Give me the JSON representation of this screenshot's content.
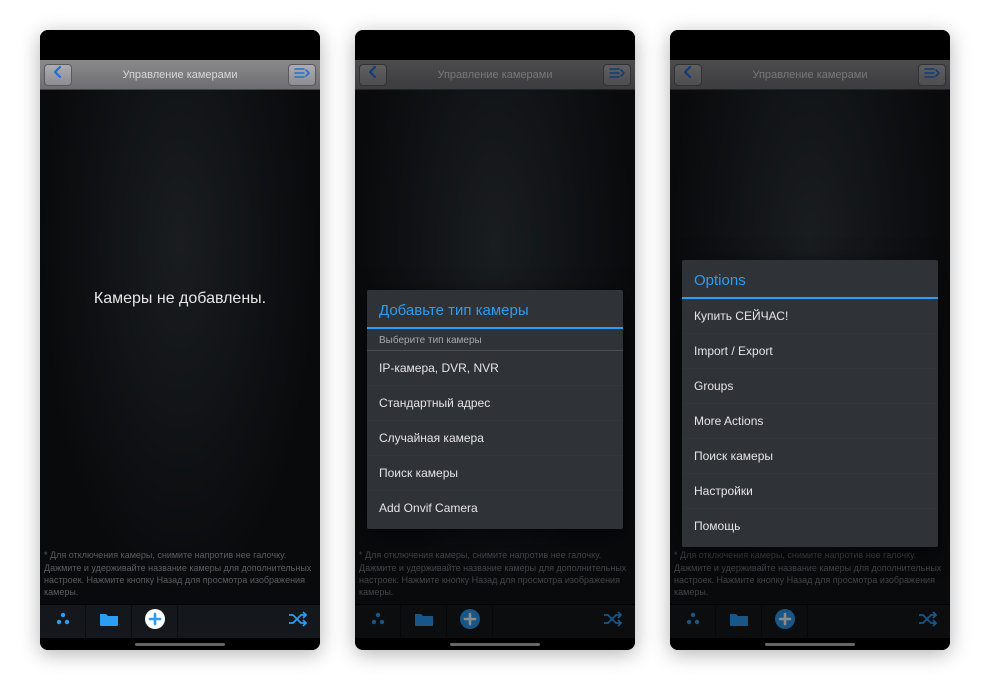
{
  "header": {
    "title": "Управление камерами"
  },
  "screen1": {
    "empty_text": "Камеры не добавлены."
  },
  "hint": "* Для отключения камеры, снимите напротив нее галочку. Дажмите и удерживайте название камеры для дополнительных настроек. Нажмите кнопку Назад для просмотра изображения камеры.",
  "dialog_camera_type": {
    "title": "Добавьте тип камеры",
    "subtitle": "Выберите тип камеры",
    "items": [
      "IP-камера, DVR, NVR",
      "Стандартный адрес",
      "Случайная камера",
      "Поиск камеры",
      "Add Onvif Camera"
    ]
  },
  "dialog_options": {
    "title": "Options",
    "items": [
      "Купить СЕЙЧАС!",
      "Import / Export",
      "Groups",
      "More Actions",
      "Поиск камеры",
      "Настройки",
      "Помощь"
    ]
  },
  "colors": {
    "accent": "#2a9df4",
    "header_bg": "#7a7a7e",
    "dialog_bg": "#2f3236"
  }
}
